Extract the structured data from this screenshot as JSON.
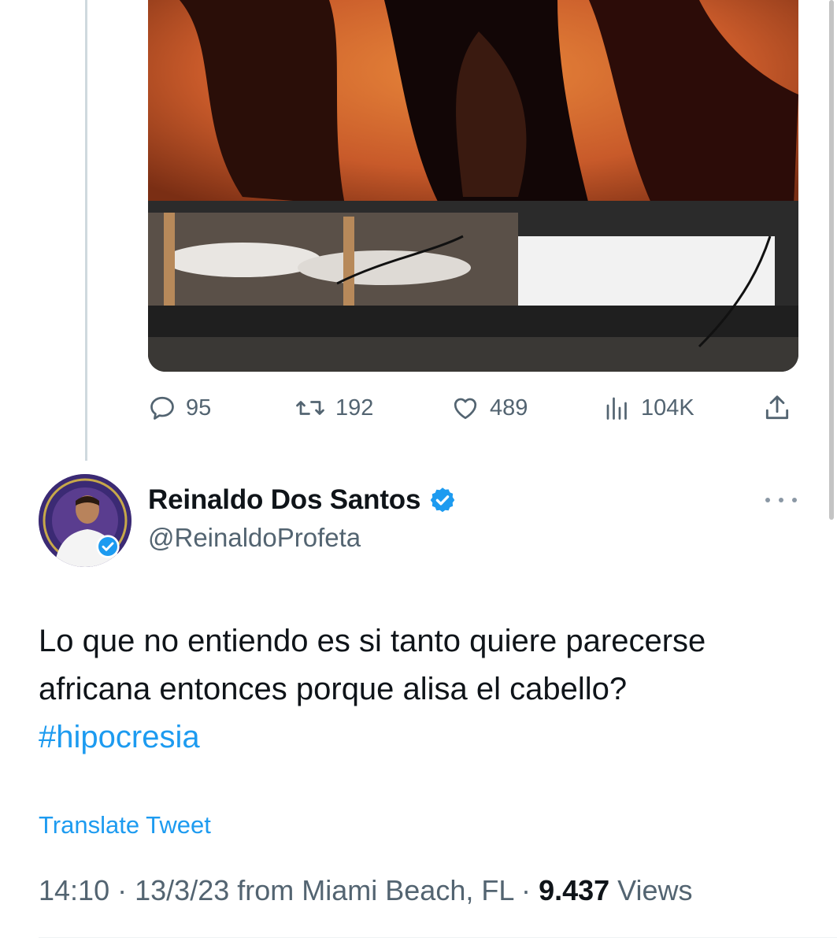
{
  "colors": {
    "accent": "#1d9bf0",
    "secondary_text": "#536471",
    "primary_text": "#0f1419",
    "thread_line": "#cfd9de"
  },
  "parent_tweet": {
    "media": {
      "icon": "photo"
    },
    "actions": {
      "replies": "95",
      "retweets": "192",
      "likes": "489",
      "views": "104K",
      "icons": [
        "reply-icon",
        "retweet-icon",
        "like-icon",
        "views-icon",
        "share-icon"
      ]
    }
  },
  "tweet": {
    "author": {
      "display_name": "Reinaldo Dos Santos",
      "handle": "@ReinaldoProfeta",
      "verified": true
    },
    "text_line_1": "Lo que no entiendo es si tanto quiere parecerse",
    "text_line_2": "africana entonces porque alisa el cabello?",
    "hashtag": "#hipocresia",
    "translate_label": "Translate Tweet",
    "meta": {
      "time": "14:10",
      "date": "13/3/23",
      "source": "from Miami Beach, FL",
      "separator": "·",
      "views_count": "9.437",
      "views_label": "Views"
    }
  }
}
